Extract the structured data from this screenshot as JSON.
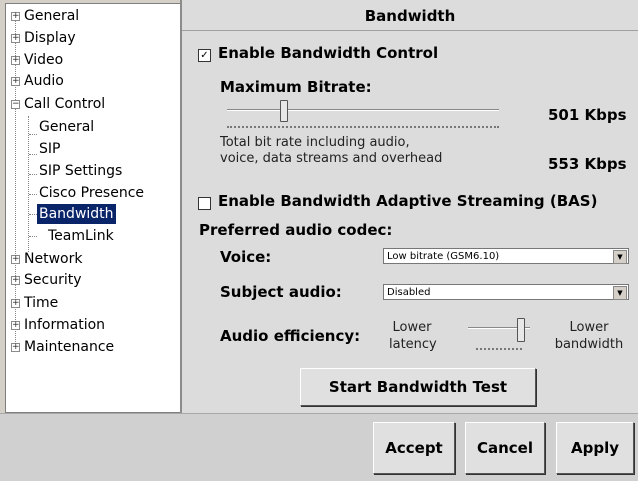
{
  "tree": {
    "items": [
      {
        "label": "General"
      },
      {
        "label": "Display"
      },
      {
        "label": "Video"
      },
      {
        "label": "Audio"
      },
      {
        "label": "Call Control"
      },
      {
        "label": "General"
      },
      {
        "label": "SIP"
      },
      {
        "label": "SIP Settings"
      },
      {
        "label": "Cisco Presence"
      },
      {
        "label": "Bandwidth"
      },
      {
        "label": "TeamLink"
      },
      {
        "label": "Network"
      },
      {
        "label": "Security"
      },
      {
        "label": "Time"
      },
      {
        "label": "Information"
      },
      {
        "label": "Maintenance"
      }
    ],
    "expand_plus": "+",
    "expand_minus": "−"
  },
  "panel": {
    "title": "Bandwidth",
    "enable_bw_control": {
      "label": "Enable Bandwidth Control",
      "checked": true,
      "check_glyph": "✓"
    },
    "max_bitrate": {
      "label": "Maximum Bitrate:",
      "value_text": "501 Kbps",
      "slider_fraction": 0.2,
      "description_line1": "Total bit rate including audio,",
      "description_line2": "voice, data streams and overhead",
      "total_text": "553 Kbps"
    },
    "enable_bas": {
      "label": "Enable Bandwidth Adaptive Streaming (BAS)",
      "checked": false
    },
    "preferred_codec_label": "Preferred audio codec:",
    "voice": {
      "label": "Voice:",
      "value": "Low bitrate (GSM6.10)"
    },
    "subject_audio": {
      "label": "Subject audio:",
      "value": "Disabled"
    },
    "dropdown_glyph": "▼",
    "audio_efficiency": {
      "label": "Audio efficiency:",
      "left_line1": "Lower",
      "left_line2": "latency",
      "right_line1": "Lower",
      "right_line2": "bandwidth",
      "slider_fraction": 0.9
    },
    "start_test_button": "Start Bandwidth Test"
  },
  "buttons": {
    "accept": "Accept",
    "cancel": "Cancel",
    "apply": "Apply"
  }
}
